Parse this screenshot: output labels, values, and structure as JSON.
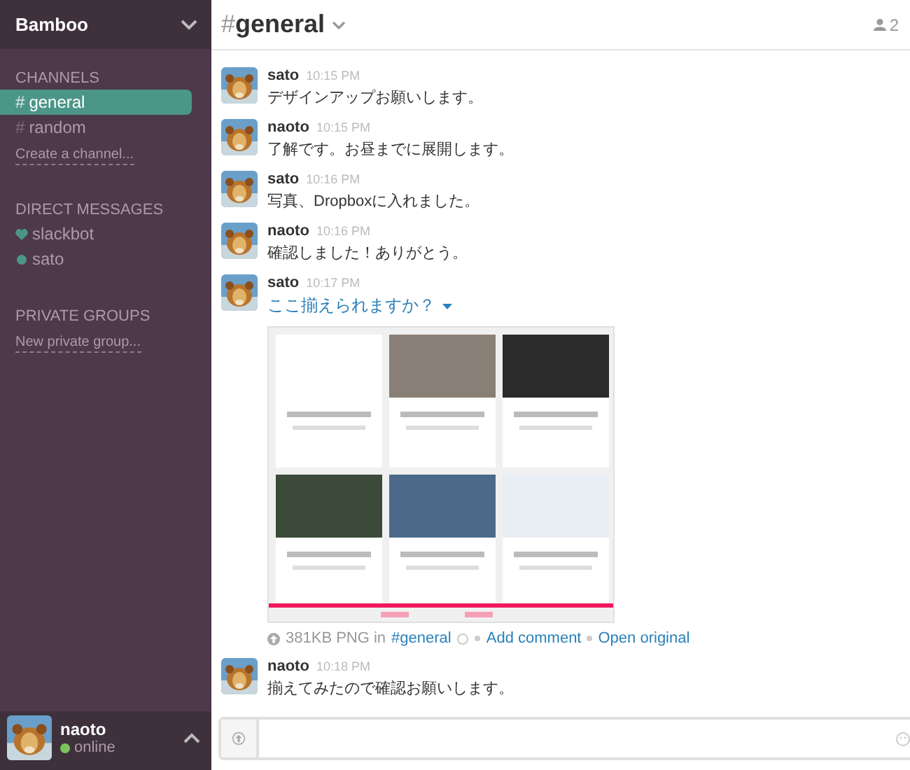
{
  "team": {
    "name": "Bamboo"
  },
  "sidebar": {
    "sections": [
      {
        "title": "CHANNELS",
        "items": [
          {
            "kind": "channel",
            "prefix": "#",
            "label": "general",
            "selected": true
          },
          {
            "kind": "channel",
            "prefix": "#",
            "label": "random",
            "selected": false
          }
        ],
        "action": "Create a channel..."
      },
      {
        "title": "DIRECT MESSAGES",
        "items": [
          {
            "kind": "heart",
            "label": "slackbot",
            "selected": false
          },
          {
            "kind": "dot",
            "label": "sato",
            "selected": false
          }
        ]
      },
      {
        "title": "PRIVATE GROUPS",
        "action": "New private group..."
      }
    ]
  },
  "user": {
    "name": "naoto",
    "status": "online"
  },
  "channel": {
    "prefix": "#",
    "name": "general",
    "member_count": "2"
  },
  "messages": [
    {
      "author": "sato",
      "time": "10:15 PM",
      "text": "デザインアップお願いします。"
    },
    {
      "author": "naoto",
      "time": "10:15 PM",
      "text": "了解です。お昼までに展開します。"
    },
    {
      "author": "sato",
      "time": "10:16 PM",
      "text": "写真、Dropboxに入れました。"
    },
    {
      "author": "naoto",
      "time": "10:16 PM",
      "text": "確認しました！ありがとう。"
    },
    {
      "author": "sato",
      "time": "10:17 PM",
      "file": {
        "title": "ここ揃えられますか？",
        "size": "381KB PNG in",
        "channel": "#general",
        "actions": [
          "Add comment",
          "Open original"
        ]
      }
    },
    {
      "author": "naoto",
      "time": "10:18 PM",
      "text": "揃えてみたので確認お願いします。"
    }
  ]
}
